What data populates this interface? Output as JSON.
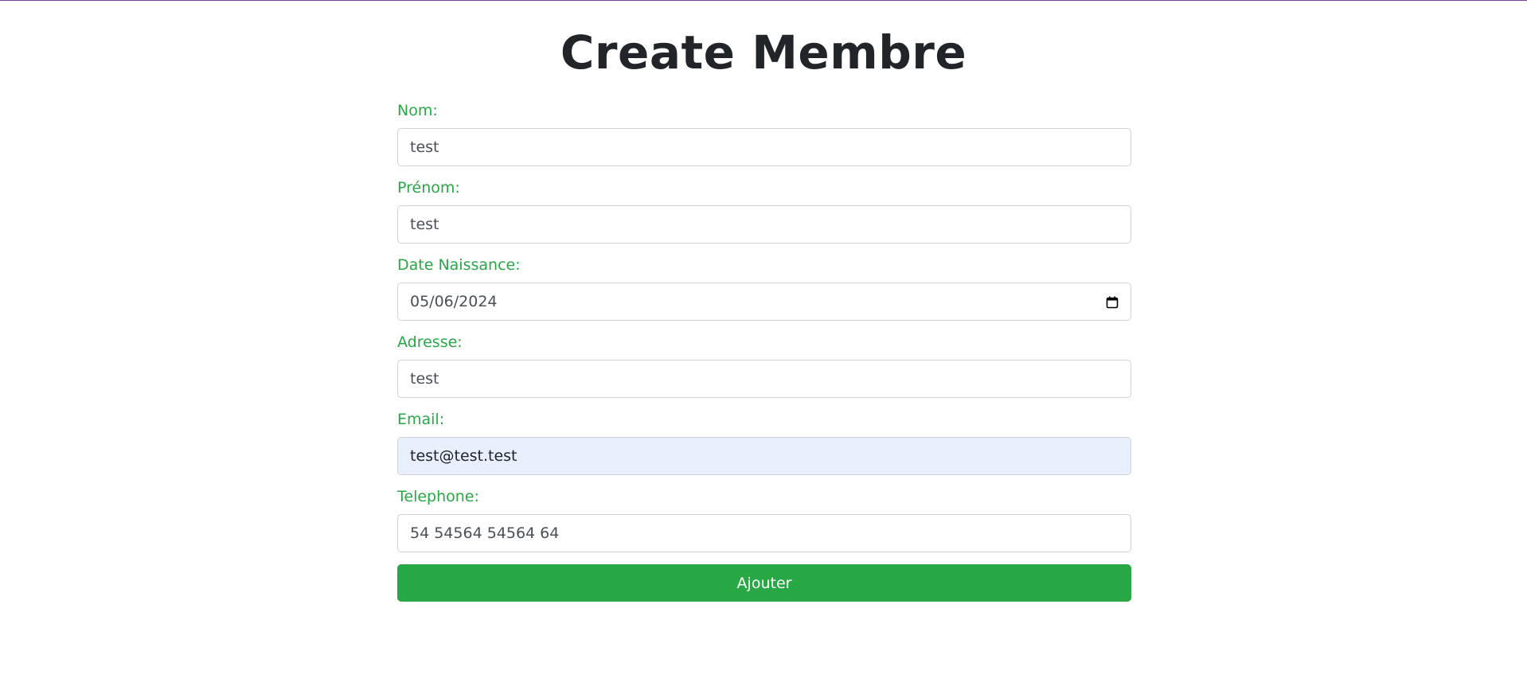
{
  "page": {
    "title": "Create Membre"
  },
  "form": {
    "fields": [
      {
        "label": "Nom:",
        "value": "test"
      },
      {
        "label": "Prénom:",
        "value": "test"
      },
      {
        "label": "Date Naissance:",
        "value": "05/06/2024"
      },
      {
        "label": "Adresse:",
        "value": "test"
      },
      {
        "label": "Email:",
        "value": "test@test.test"
      },
      {
        "label": "Telephone:",
        "value": "54 54564 54564 64"
      }
    ],
    "submit_label": "Ajouter"
  },
  "icons": {
    "date_picker": "calendar-icon"
  },
  "colors": {
    "label_green": "#28a745",
    "button_green": "#28a745",
    "title_text": "#212529",
    "autofill_background": "#e8f0fe",
    "top_border": "#7b3f98"
  }
}
